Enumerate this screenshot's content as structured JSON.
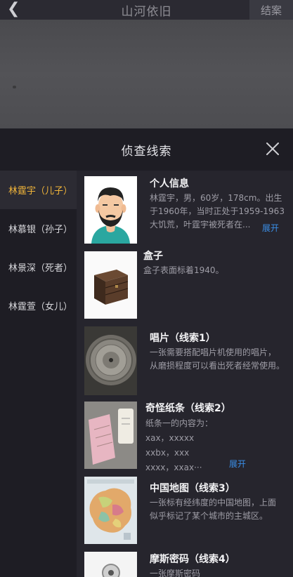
{
  "topbar": {
    "back_icon": "chevron-left-icon",
    "title": "山河依旧",
    "end_button": "结案"
  },
  "panel": {
    "title": "侦查线索",
    "close_icon": "close-icon"
  },
  "sidebar": {
    "items": [
      {
        "label": "林霆宇（儿子）",
        "active": true
      },
      {
        "label": "林慕银（孙子）",
        "active": false
      },
      {
        "label": "林景深（死者）",
        "active": false
      },
      {
        "label": "林霆萱（女儿）",
        "active": false
      }
    ]
  },
  "clues": [
    {
      "title": "个人信息",
      "lines": [
        "林霆宇，男，60岁，178cm。出生",
        "于1960年，当时正处于1959-1963",
        "大饥荒，叶霆宇被死者在..."
      ],
      "expand": "展开",
      "image": "avatar-illustration"
    },
    {
      "title": "盒子",
      "lines": [
        "盒子表面标着1940。"
      ],
      "image": "wooden-box-photo"
    },
    {
      "title": "唱片（线索1）",
      "lines": [
        "一张需要搭配唱片机使用的唱片，",
        "从磨损程度可以看出死者经常使用。"
      ],
      "image": "vinyl-record-photo"
    },
    {
      "title": "奇怪纸条（线索2）",
      "lines": [
        "纸条一的内容为：",
        "xax，xxxxx",
        "xxbx，xxx",
        "xxxx，xxax···"
      ],
      "expand": "展开",
      "image": "paper-notes-photo"
    },
    {
      "title": "中国地图（线索3）",
      "lines": [
        "一张标有经纬度的中国地图，上面",
        "似乎标记了某个城市的主城区。"
      ],
      "image": "china-map-photo"
    },
    {
      "title": "摩斯密码（线索4）",
      "lines": [
        "一张摩斯密码"
      ],
      "image": "morse-device-photo"
    }
  ],
  "colors": {
    "accent": "#f1b53a",
    "link": "#3a8fe8",
    "background": "#1e1d24"
  }
}
